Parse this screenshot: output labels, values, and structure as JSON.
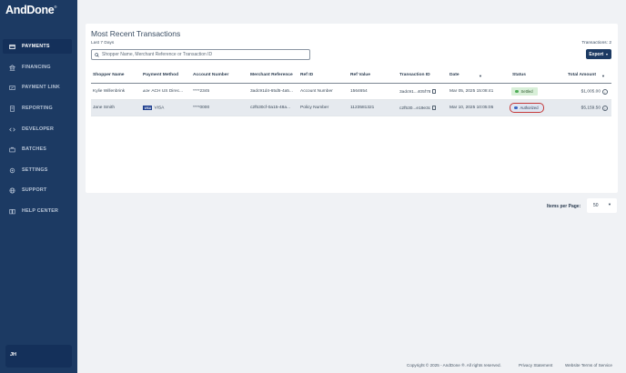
{
  "brand": {
    "name": "AndDone",
    "mark": "®"
  },
  "sidebar": {
    "items": [
      {
        "label": "PAYMENTS",
        "icon": "payments-icon",
        "active": true
      },
      {
        "label": "FINANCING",
        "icon": "bank-icon",
        "active": false
      },
      {
        "label": "PAYMENT LINK",
        "icon": "link-icon",
        "active": false
      },
      {
        "label": "REPORTING",
        "icon": "report-icon",
        "active": false
      },
      {
        "label": "DEVELOPER",
        "icon": "code-icon",
        "active": false
      },
      {
        "label": "BATCHES",
        "icon": "briefcase-icon",
        "active": false
      },
      {
        "label": "SETTINGS",
        "icon": "gear-icon",
        "active": false
      },
      {
        "label": "SUPPORT",
        "icon": "globe-icon",
        "active": false
      },
      {
        "label": "HELP CENTER",
        "icon": "book-icon",
        "active": false
      }
    ],
    "user_initials": "JH"
  },
  "transactions": {
    "title": "Most Recent Transactions",
    "period": "Last 7 Days",
    "search_placeholder": "Shopper Name, Merchant Reference or Transaction ID",
    "count_label": "Transactions: 2",
    "export_label": "Export",
    "columns": [
      "Shopper Name",
      "Payment Method",
      "Account Number",
      "Merchant Reference",
      "Ref ID",
      "Ref Value",
      "Transaction ID",
      "Date",
      "Status",
      "Total Amount"
    ],
    "rows": [
      {
        "shopper": "Kylie Willenbrink",
        "method_logo": "ACH",
        "method": "ACH US Direc...",
        "account": "****2345",
        "merchant_ref": "3adc91d4-65d5-4a5...",
        "ref_id": "Account Number",
        "ref_value": "1564654",
        "txn_id": "3adc91...405f78",
        "date": "Mar 05, 2025 15:08:41",
        "status": "Settled",
        "amount": "$1,005.00"
      },
      {
        "shopper": "Jane Smith",
        "method_logo": "VISA",
        "method": "VISA",
        "account": "****0000",
        "merchant_ref": "c2f530cf-0a15-48a...",
        "ref_id": "Policy Number",
        "ref_value": "1123581321",
        "txn_id": "c2f530...e19e3c",
        "date": "Mar 10, 2025 10:05:05",
        "status": "Authorized",
        "amount": "$5,159.50"
      }
    ]
  },
  "pager": {
    "label": "Items per Page:",
    "value": "50"
  },
  "footer": {
    "copyright": "Copyright © 2025 - AndDone ®. All rights reserved.",
    "privacy": "Privacy Statement",
    "terms": "Website Terms of Service"
  },
  "colors": {
    "sidebar": "#1c3a63",
    "settled": "#4fae56",
    "authorized": "#3b64c2",
    "highlight": "#c53a3a"
  }
}
